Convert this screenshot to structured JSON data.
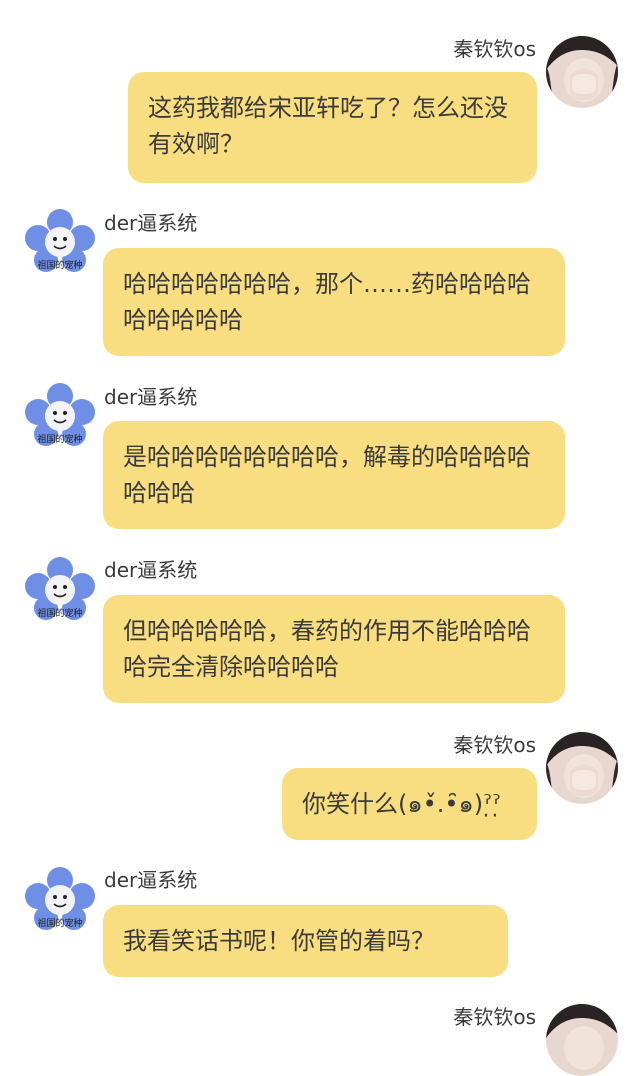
{
  "messages": [
    {
      "sender": "秦钦钦os",
      "side": "right",
      "text": "这药我都给宋亚轩吃了？怎么还没有效啊？"
    },
    {
      "sender": "der逼系统",
      "side": "left",
      "avatar_caption": "祖国的宠种",
      "text": "哈哈哈哈哈哈哈，那个……药哈哈哈哈哈哈哈哈哈"
    },
    {
      "sender": "der逼系统",
      "side": "left",
      "avatar_caption": "祖国的宠种",
      "text": "是哈哈哈哈哈哈哈哈，解毒的哈哈哈哈哈哈哈"
    },
    {
      "sender": "der逼系统",
      "side": "left",
      "avatar_caption": "祖国的宠种",
      "text": "但哈哈哈哈哈，春药的作用不能哈哈哈哈完全清除哈哈哈哈"
    },
    {
      "sender": "秦钦钦os",
      "side": "right",
      "text": "你笑什么(๑•̌.•̑๑)ˀ̣ˀ̣"
    },
    {
      "sender": "der逼系统",
      "side": "left",
      "avatar_caption": "祖国的宠种",
      "text": "我看笑话书呢！你管的着吗？"
    },
    {
      "sender": "秦钦钦os",
      "side": "right",
      "text": ""
    }
  ],
  "colors": {
    "bubble": "#f8de81",
    "background": "#ffffff"
  },
  "icons": {
    "user_avatar": "girl-face-avatar-icon",
    "bot_avatar": "blue-flower-meme-avatar-icon"
  }
}
